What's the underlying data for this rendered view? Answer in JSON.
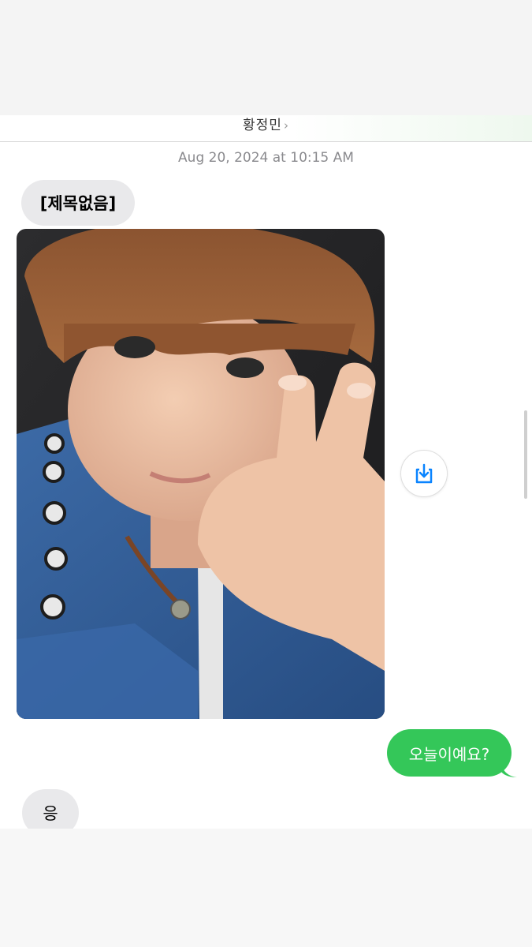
{
  "header": {
    "contact_name": "황정민",
    "chevron_icon": "chevron-right-icon"
  },
  "conversation": {
    "timestamp_date": "Aug 20, 2024",
    "timestamp_time": "at 10:15 AM",
    "messages": [
      {
        "direction": "incoming",
        "type": "text",
        "text": "[제목없음]"
      },
      {
        "direction": "incoming",
        "type": "image"
      },
      {
        "direction": "outgoing",
        "type": "text",
        "text": "오늘이예요?"
      },
      {
        "direction": "incoming",
        "type": "text",
        "text": "응"
      }
    ]
  },
  "actions": {
    "save_icon": "save-to-photos-icon"
  },
  "colors": {
    "incoming_bubble": "#e9e9eb",
    "outgoing_bubble": "#34c759",
    "accent": "#0a84ff"
  }
}
